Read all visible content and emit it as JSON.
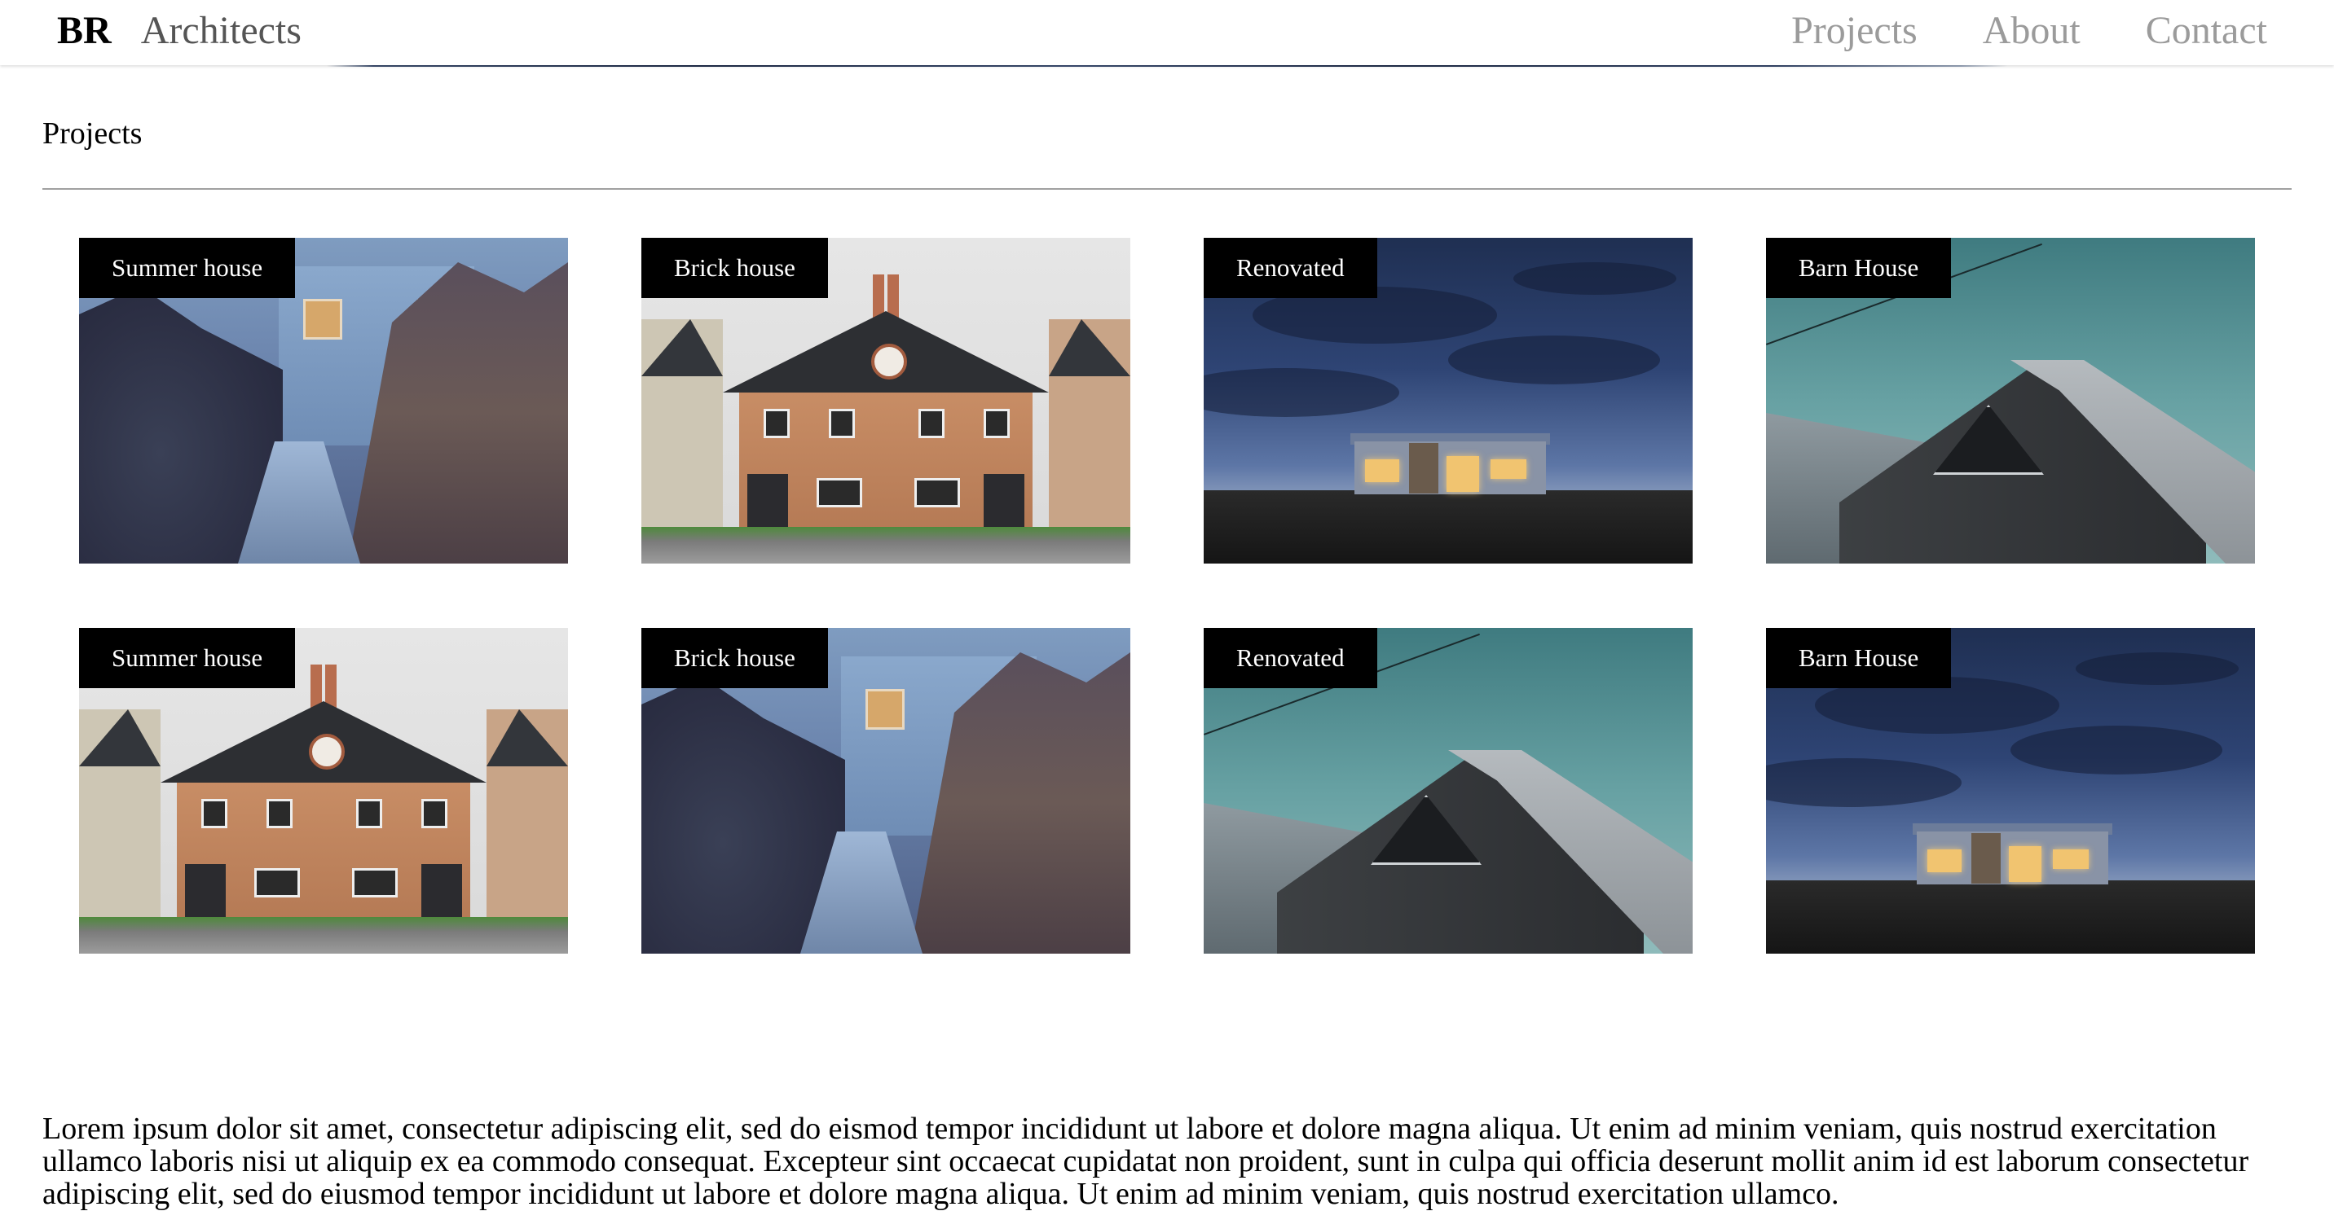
{
  "header": {
    "brand_mark": "BR",
    "brand_name": "Architects",
    "nav": [
      "Projects",
      "About",
      "Contact"
    ]
  },
  "section": {
    "title": "Projects"
  },
  "projects": [
    {
      "label": "Summer house",
      "scene": "boardwalk"
    },
    {
      "label": "Brick house",
      "scene": "brick"
    },
    {
      "label": "Renovated",
      "scene": "night"
    },
    {
      "label": "Barn House",
      "scene": "barn"
    },
    {
      "label": "Summer house",
      "scene": "brick"
    },
    {
      "label": "Brick house",
      "scene": "boardwalk"
    },
    {
      "label": "Renovated",
      "scene": "barn"
    },
    {
      "label": "Barn House",
      "scene": "night"
    }
  ],
  "body_text": "Lorem ipsum dolor sit amet, consectetur adipiscing elit, sed do eismod tempor incididunt ut labore et dolore magna aliqua. Ut enim ad minim veniam, quis nostrud exercitation ullamco laboris nisi ut aliquip ex ea commodo consequat. Excepteur sint occaecat cupidatat non proident, sunt in culpa qui officia deserunt mollit anim id est laborum consectetur adipiscing elit, sed do eiusmod tempor incididunt ut labore et dolore magna aliqua. Ut enim ad minim veniam, quis nostrud exercitation ullamco."
}
